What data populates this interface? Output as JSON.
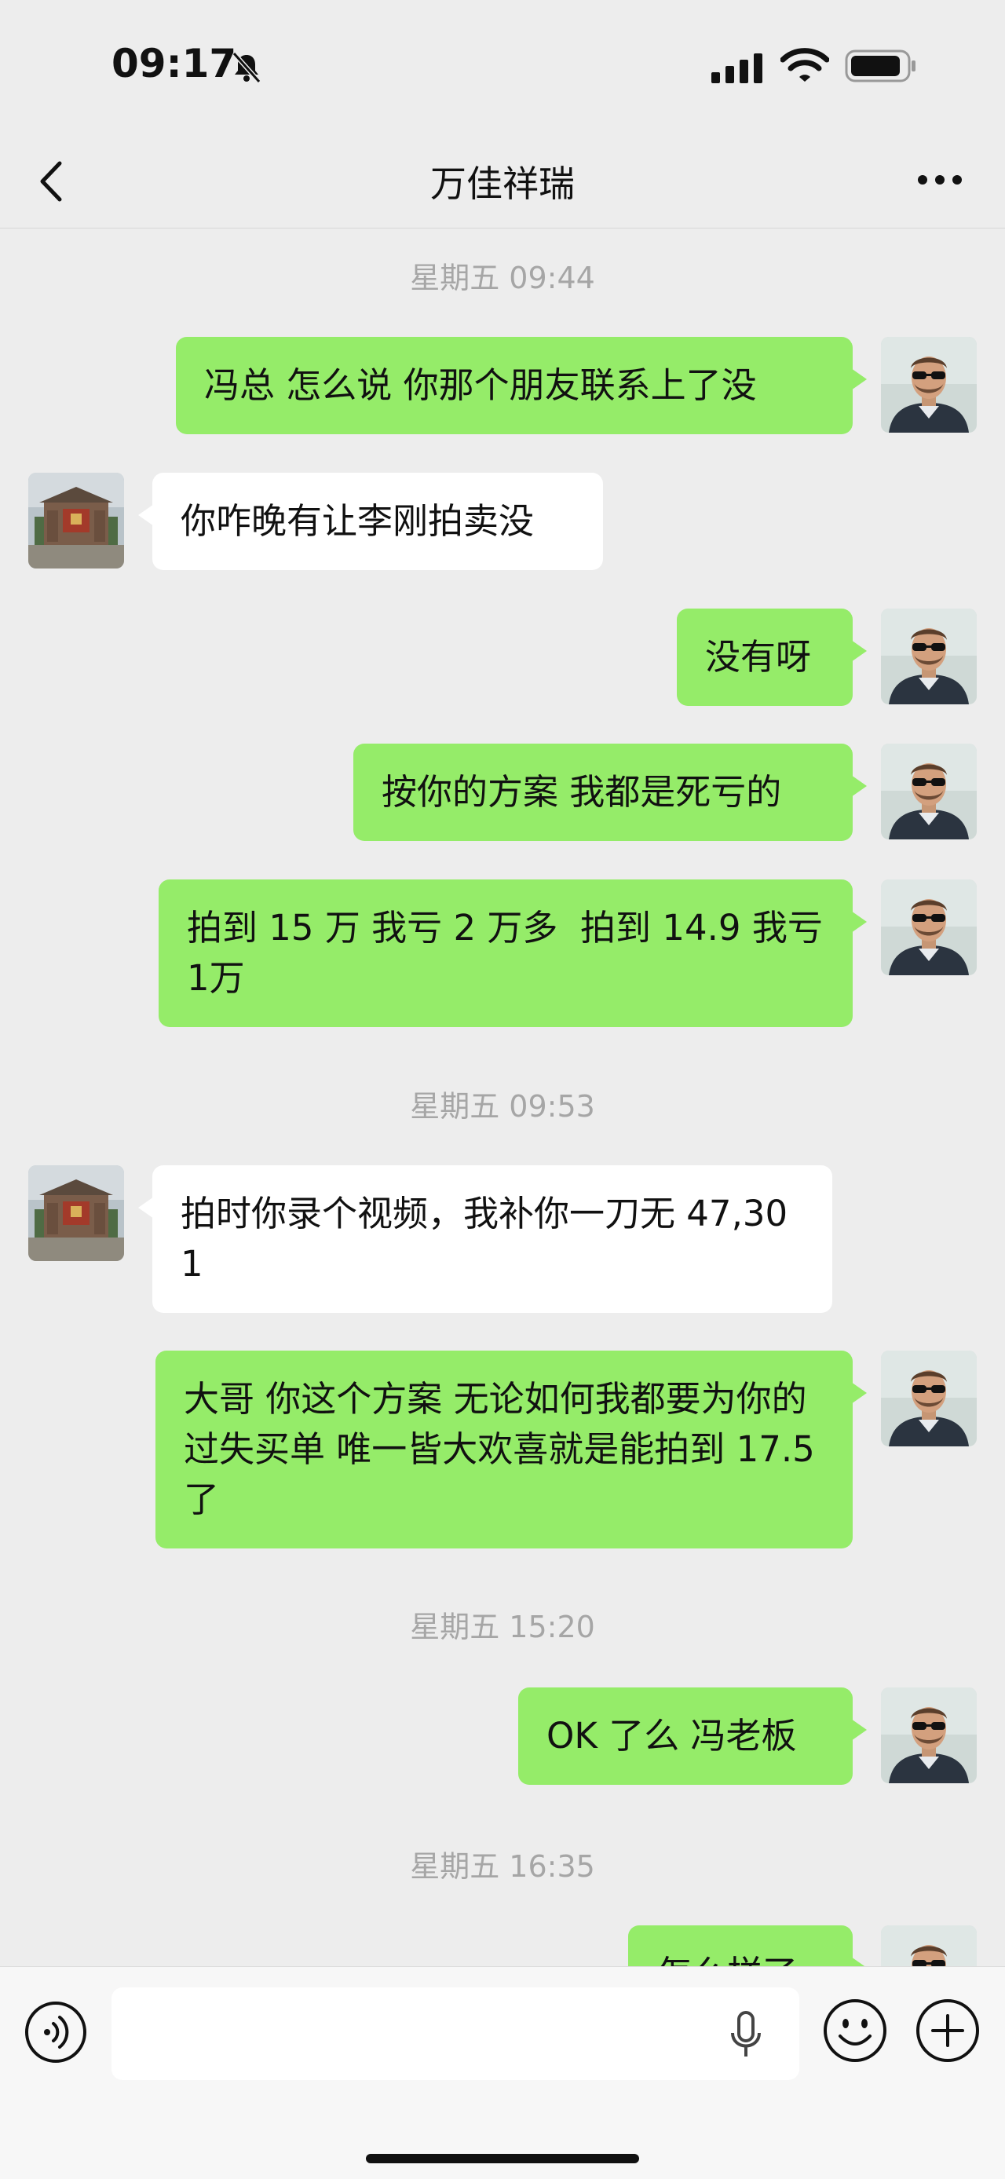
{
  "status_bar": {
    "time": "09:17"
  },
  "header": {
    "title": "万佳祥瑞"
  },
  "messages": [
    {
      "type": "timestamp",
      "text": "星期五 09:44"
    },
    {
      "type": "me",
      "text": "冯总 怎么说 你那个朋友联系上了没"
    },
    {
      "type": "them",
      "text": "你咋晚有让李刚拍卖没"
    },
    {
      "type": "me",
      "text": "没有呀"
    },
    {
      "type": "me",
      "text": "按你的方案 我都是死亏的"
    },
    {
      "type": "me",
      "text": "拍到 15 万 我亏 2 万多  拍到 14.9 我亏 1万"
    },
    {
      "type": "timestamp",
      "text": "星期五 09:53"
    },
    {
      "type": "them",
      "text": "拍时你录个视频，我补你一刀无 47,301"
    },
    {
      "type": "me",
      "text": "大哥 你这个方案 无论如何我都要为你的过失买单 唯一皆大欢喜就是能拍到 17.5 了"
    },
    {
      "type": "timestamp",
      "text": "星期五 15:20"
    },
    {
      "type": "me",
      "text": "OK 了么 冯老板"
    },
    {
      "type": "timestamp",
      "text": "星期五 16:35"
    },
    {
      "type": "me",
      "text": "怎么样了"
    }
  ],
  "input_bar": {
    "placeholder": ""
  },
  "colors": {
    "my_bubble": "#95ec69",
    "their_bubble": "#ffffff",
    "background": "#ededed"
  }
}
